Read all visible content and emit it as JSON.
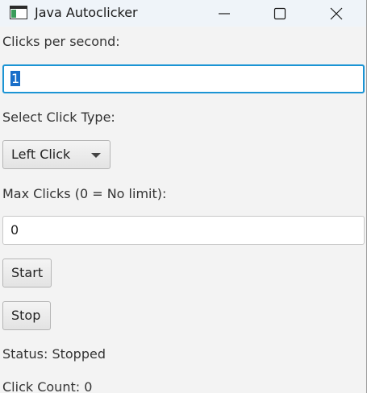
{
  "window": {
    "title": "Java Autoclicker",
    "app_icon": "java-app-icon",
    "controls": [
      "minimize-icon",
      "maximize-icon",
      "close-icon"
    ]
  },
  "form": {
    "cps_label": "Clicks per second:",
    "cps_value": "1",
    "click_type_label": "Select Click Type:",
    "click_type_selected": "Left Click",
    "max_clicks_label": "Max Clicks (0 = No limit):",
    "max_clicks_value": "0",
    "start_label": "Start",
    "stop_label": "Stop",
    "status_text": "Status: Stopped",
    "click_count_text": "Click Count: 0"
  },
  "colors": {
    "focus_border": "#1b94d4",
    "selection": "#1a6fc9",
    "titlebar": "#eff4f9",
    "background": "#f3f3f3"
  }
}
